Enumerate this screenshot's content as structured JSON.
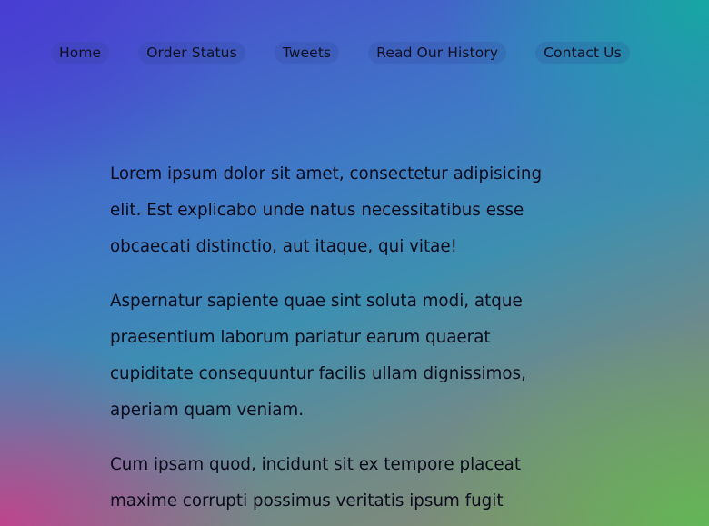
{
  "nav": {
    "items": [
      {
        "label": "Home"
      },
      {
        "label": "Order Status"
      },
      {
        "label": "Tweets"
      },
      {
        "label": "Read Our History"
      },
      {
        "label": "Contact Us"
      }
    ]
  },
  "content": {
    "paragraphs": [
      "Lorem ipsum dolor sit amet, consectetur adipisicing elit. Est explicabo unde natus necessitatibus esse obcaecati distinctio, aut itaque, qui vitae!",
      "Aspernatur sapiente quae sint soluta modi, atque praesentium laborum pariatur earum quaerat cupiditate consequuntur facilis ullam dignissimos, aperiam quam veniam.",
      "Cum ipsam quod, incidunt sit ex tempore placeat maxime corrupti possimus veritatis ipsum fugit"
    ]
  }
}
